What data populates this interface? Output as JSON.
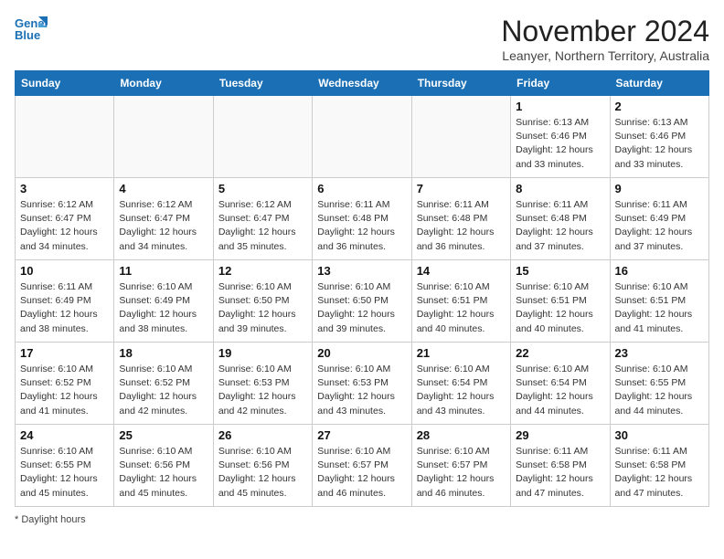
{
  "header": {
    "logo_line1": "General",
    "logo_line2": "Blue",
    "month_title": "November 2024",
    "subtitle": "Leanyer, Northern Territory, Australia"
  },
  "days_of_week": [
    "Sunday",
    "Monday",
    "Tuesday",
    "Wednesday",
    "Thursday",
    "Friday",
    "Saturday"
  ],
  "weeks": [
    [
      {
        "day": "",
        "info": ""
      },
      {
        "day": "",
        "info": ""
      },
      {
        "day": "",
        "info": ""
      },
      {
        "day": "",
        "info": ""
      },
      {
        "day": "",
        "info": ""
      },
      {
        "day": "1",
        "info": "Sunrise: 6:13 AM\nSunset: 6:46 PM\nDaylight: 12 hours\nand 33 minutes."
      },
      {
        "day": "2",
        "info": "Sunrise: 6:13 AM\nSunset: 6:46 PM\nDaylight: 12 hours\nand 33 minutes."
      }
    ],
    [
      {
        "day": "3",
        "info": "Sunrise: 6:12 AM\nSunset: 6:47 PM\nDaylight: 12 hours\nand 34 minutes."
      },
      {
        "day": "4",
        "info": "Sunrise: 6:12 AM\nSunset: 6:47 PM\nDaylight: 12 hours\nand 34 minutes."
      },
      {
        "day": "5",
        "info": "Sunrise: 6:12 AM\nSunset: 6:47 PM\nDaylight: 12 hours\nand 35 minutes."
      },
      {
        "day": "6",
        "info": "Sunrise: 6:11 AM\nSunset: 6:48 PM\nDaylight: 12 hours\nand 36 minutes."
      },
      {
        "day": "7",
        "info": "Sunrise: 6:11 AM\nSunset: 6:48 PM\nDaylight: 12 hours\nand 36 minutes."
      },
      {
        "day": "8",
        "info": "Sunrise: 6:11 AM\nSunset: 6:48 PM\nDaylight: 12 hours\nand 37 minutes."
      },
      {
        "day": "9",
        "info": "Sunrise: 6:11 AM\nSunset: 6:49 PM\nDaylight: 12 hours\nand 37 minutes."
      }
    ],
    [
      {
        "day": "10",
        "info": "Sunrise: 6:11 AM\nSunset: 6:49 PM\nDaylight: 12 hours\nand 38 minutes."
      },
      {
        "day": "11",
        "info": "Sunrise: 6:10 AM\nSunset: 6:49 PM\nDaylight: 12 hours\nand 38 minutes."
      },
      {
        "day": "12",
        "info": "Sunrise: 6:10 AM\nSunset: 6:50 PM\nDaylight: 12 hours\nand 39 minutes."
      },
      {
        "day": "13",
        "info": "Sunrise: 6:10 AM\nSunset: 6:50 PM\nDaylight: 12 hours\nand 39 minutes."
      },
      {
        "day": "14",
        "info": "Sunrise: 6:10 AM\nSunset: 6:51 PM\nDaylight: 12 hours\nand 40 minutes."
      },
      {
        "day": "15",
        "info": "Sunrise: 6:10 AM\nSunset: 6:51 PM\nDaylight: 12 hours\nand 40 minutes."
      },
      {
        "day": "16",
        "info": "Sunrise: 6:10 AM\nSunset: 6:51 PM\nDaylight: 12 hours\nand 41 minutes."
      }
    ],
    [
      {
        "day": "17",
        "info": "Sunrise: 6:10 AM\nSunset: 6:52 PM\nDaylight: 12 hours\nand 41 minutes."
      },
      {
        "day": "18",
        "info": "Sunrise: 6:10 AM\nSunset: 6:52 PM\nDaylight: 12 hours\nand 42 minutes."
      },
      {
        "day": "19",
        "info": "Sunrise: 6:10 AM\nSunset: 6:53 PM\nDaylight: 12 hours\nand 42 minutes."
      },
      {
        "day": "20",
        "info": "Sunrise: 6:10 AM\nSunset: 6:53 PM\nDaylight: 12 hours\nand 43 minutes."
      },
      {
        "day": "21",
        "info": "Sunrise: 6:10 AM\nSunset: 6:54 PM\nDaylight: 12 hours\nand 43 minutes."
      },
      {
        "day": "22",
        "info": "Sunrise: 6:10 AM\nSunset: 6:54 PM\nDaylight: 12 hours\nand 44 minutes."
      },
      {
        "day": "23",
        "info": "Sunrise: 6:10 AM\nSunset: 6:55 PM\nDaylight: 12 hours\nand 44 minutes."
      }
    ],
    [
      {
        "day": "24",
        "info": "Sunrise: 6:10 AM\nSunset: 6:55 PM\nDaylight: 12 hours\nand 45 minutes."
      },
      {
        "day": "25",
        "info": "Sunrise: 6:10 AM\nSunset: 6:56 PM\nDaylight: 12 hours\nand 45 minutes."
      },
      {
        "day": "26",
        "info": "Sunrise: 6:10 AM\nSunset: 6:56 PM\nDaylight: 12 hours\nand 45 minutes."
      },
      {
        "day": "27",
        "info": "Sunrise: 6:10 AM\nSunset: 6:57 PM\nDaylight: 12 hours\nand 46 minutes."
      },
      {
        "day": "28",
        "info": "Sunrise: 6:10 AM\nSunset: 6:57 PM\nDaylight: 12 hours\nand 46 minutes."
      },
      {
        "day": "29",
        "info": "Sunrise: 6:11 AM\nSunset: 6:58 PM\nDaylight: 12 hours\nand 47 minutes."
      },
      {
        "day": "30",
        "info": "Sunrise: 6:11 AM\nSunset: 6:58 PM\nDaylight: 12 hours\nand 47 minutes."
      }
    ]
  ],
  "footer": "Daylight hours"
}
